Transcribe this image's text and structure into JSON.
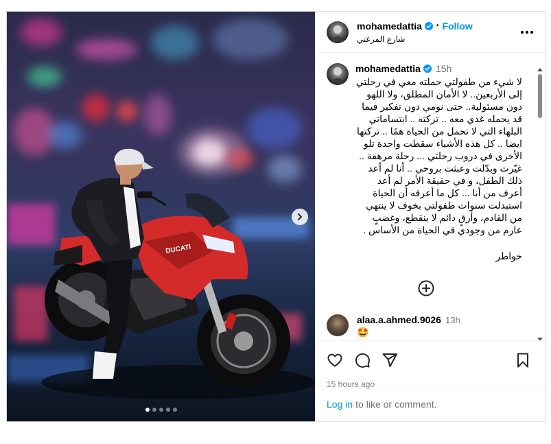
{
  "header": {
    "username": "mohamedattia",
    "separator": "•",
    "follow_label": "Follow",
    "location": "شارع المرغني",
    "more_icon": "more-horizontal-icon"
  },
  "post": {
    "username": "mohamedattia",
    "time": "15h",
    "caption": "لا شيء من طفولتي حملته معي في رحلتي إلى الأربعين.. لا الأمان المطلق، ولا اللهو دون مسئولية.. حتى نومي دون تفكير فيما قد يحمله غدي معه .. تركته .. ابتساماتي البلهاء التي لا تحمل من الحياة همًا .. تركتها ايضا .. كل هذه الأشياء سقطت واحدة تلو الأخرى في دروب رحلتي ... رحلة مرهقة .. غيّرت وبدّلت وعبثت بروحي .. أنا لم أعد ذلك الطفل، و في حقيقة الأمر لم أعد أعرف من أنا ... كل ما أعرفه أن الحياة استبدلت سنوات طفولتي بخوف لا ينتهي من القادم، وأرقٍ دائم لا ينقطع، وغضبٍ عارم من وجودي في الحياة من الأساس .",
    "signature": "خواطر"
  },
  "comment": {
    "username": "alaa.a.ahmed.9026",
    "time": "13h",
    "text": "🤩"
  },
  "footer": {
    "posted_time": "15 hours ago",
    "login_link": "Log in",
    "login_rest": "to like or comment."
  },
  "carousel": {
    "current": 1,
    "total": 5
  },
  "colors": {
    "accent": "#0095f6",
    "muted": "#737373",
    "border": "#dbdbdb",
    "bike_red": "#d42a2a"
  }
}
